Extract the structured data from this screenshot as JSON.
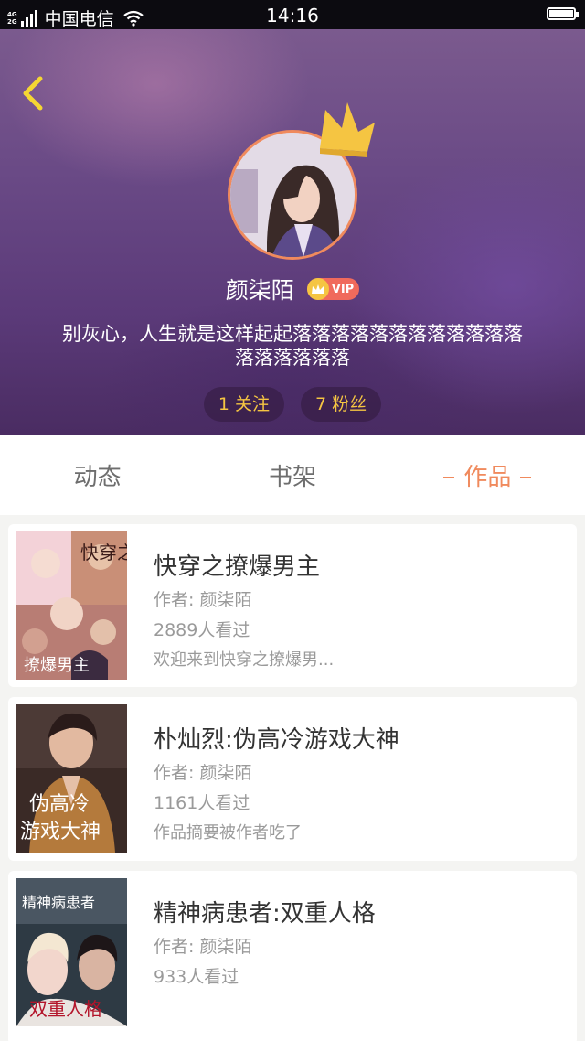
{
  "status_bar": {
    "network_top": "4G",
    "network_bottom": "2G",
    "carrier": "中国电信",
    "time": "14:16"
  },
  "profile": {
    "name": "颜柒陌",
    "vip_label": "VIP",
    "bio_line1": "别灰心，人生就是这样起起落落落落落落落落落落落落",
    "bio_line2": "落落落落落落",
    "following": "1 关注",
    "followers": "7 粉丝"
  },
  "tabs": [
    {
      "label": "动态"
    },
    {
      "label": "书架"
    },
    {
      "label": "作品",
      "active": true
    }
  ],
  "works": [
    {
      "title": "快穿之撩爆男主",
      "author": "作者: 颜柒陌",
      "views": "2889人看过",
      "summary": "欢迎来到快穿之撩爆男...",
      "cover_text_top": "快穿之",
      "cover_text_bottom": "撩爆男主"
    },
    {
      "title": "朴灿烈:伪高冷游戏大神",
      "author": "作者: 颜柒陌",
      "views": "1161人看过",
      "summary": "作品摘要被作者吃了",
      "cover_text_top": "伪高冷",
      "cover_text_bottom": "游戏大神"
    },
    {
      "title": "精神病患者:双重人格",
      "author": "作者: 颜柒陌",
      "views": "933人看过",
      "cover_text_top": "精神病患者",
      "cover_text_bottom": "双重人格"
    }
  ],
  "colors": {
    "accent": "#f08a5d",
    "gold": "#f5c542",
    "vip_badge": "#f06a5c"
  }
}
